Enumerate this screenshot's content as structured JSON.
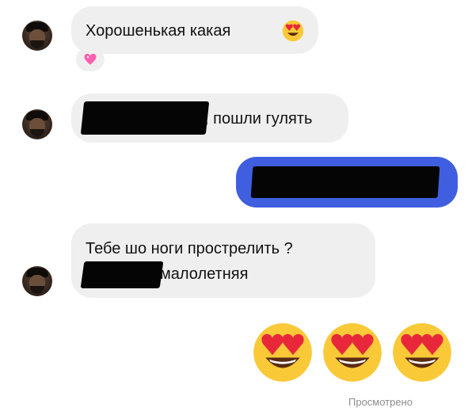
{
  "messages": [
    {
      "text": "Хорошенькая какая",
      "emoji": "heart-eyes-emoji",
      "reaction": "sparkling-heart-emoji"
    },
    {
      "text": ", пошли гулять"
    },
    {
      "line1": "Тебе шо ноги прострелить ?",
      "line2": "малолетняя"
    }
  ],
  "status": {
    "seen_label": "Просмотрено"
  },
  "colors": {
    "outgoing_bubble": "#3f5fe0",
    "incoming_bubble": "#efefef",
    "emoji_face": "#f9c938",
    "heart": "#e8283a"
  }
}
